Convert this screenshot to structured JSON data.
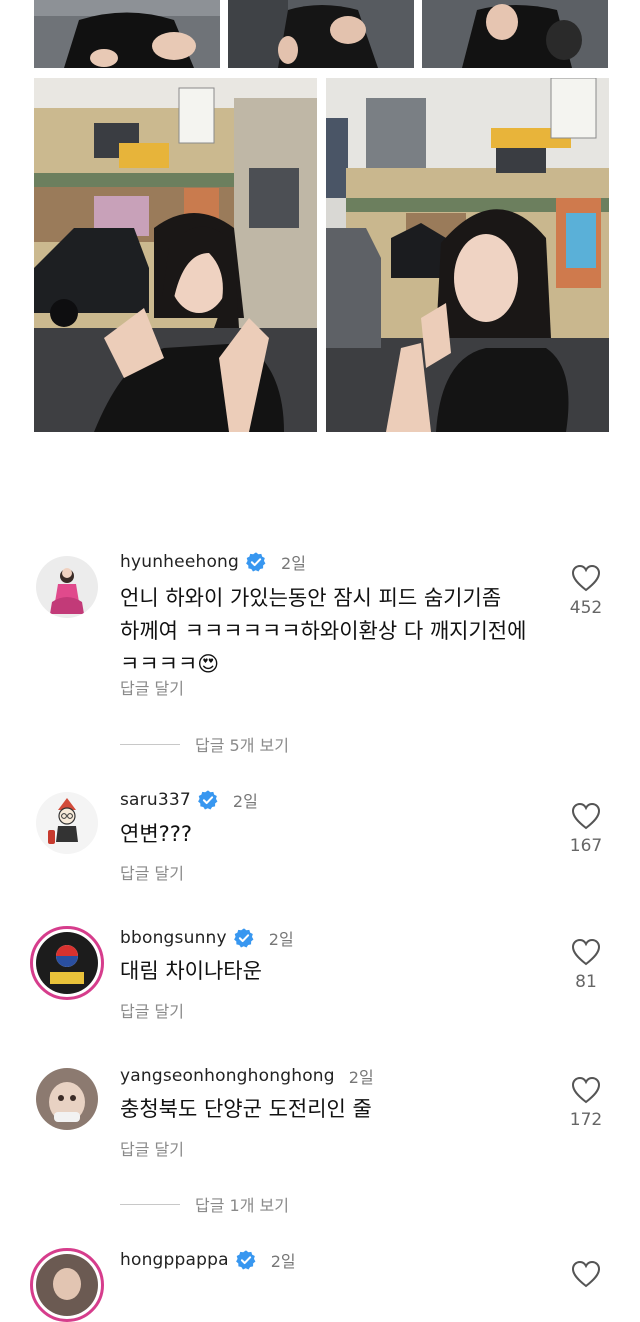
{
  "comments": [
    {
      "username": "hyunheehong",
      "verified": true,
      "age": "2일",
      "lines": [
        "언니 하와이 가있는동안 잠시 피드 숨기기좀",
        "하께여 ㅋㅋㅋㅋㅋㅋ하와이환상 다 깨지기전에",
        "ㅋㅋㅋㅋ"
      ],
      "emoji": "😍",
      "reply_label": "답글 달기",
      "likes": "452",
      "view_replies": "답글 5개 보기"
    },
    {
      "username": "saru337",
      "verified": true,
      "age": "2일",
      "lines": [
        "연변???"
      ],
      "reply_label": "답글 달기",
      "likes": "167"
    },
    {
      "username": "bbongsunny",
      "verified": true,
      "age": "2일",
      "lines": [
        "대림 차이나타운"
      ],
      "reply_label": "답글 달기",
      "likes": "81"
    },
    {
      "username": "yangseonhonghonghong",
      "verified": false,
      "age": "2일",
      "lines": [
        "충청북도 단양군 도전리인 줄"
      ],
      "reply_label": "답글 달기",
      "likes": "172",
      "view_replies": "답글 1개 보기"
    },
    {
      "username": "hongppappa",
      "verified": true,
      "age": "2일"
    }
  ],
  "colors": {
    "verified_blue": "#3897f0",
    "story_ring": "#d63d8c",
    "muted_text": "#8a8a8a"
  },
  "icons": [
    "heart-icon",
    "verified-badge-icon"
  ]
}
